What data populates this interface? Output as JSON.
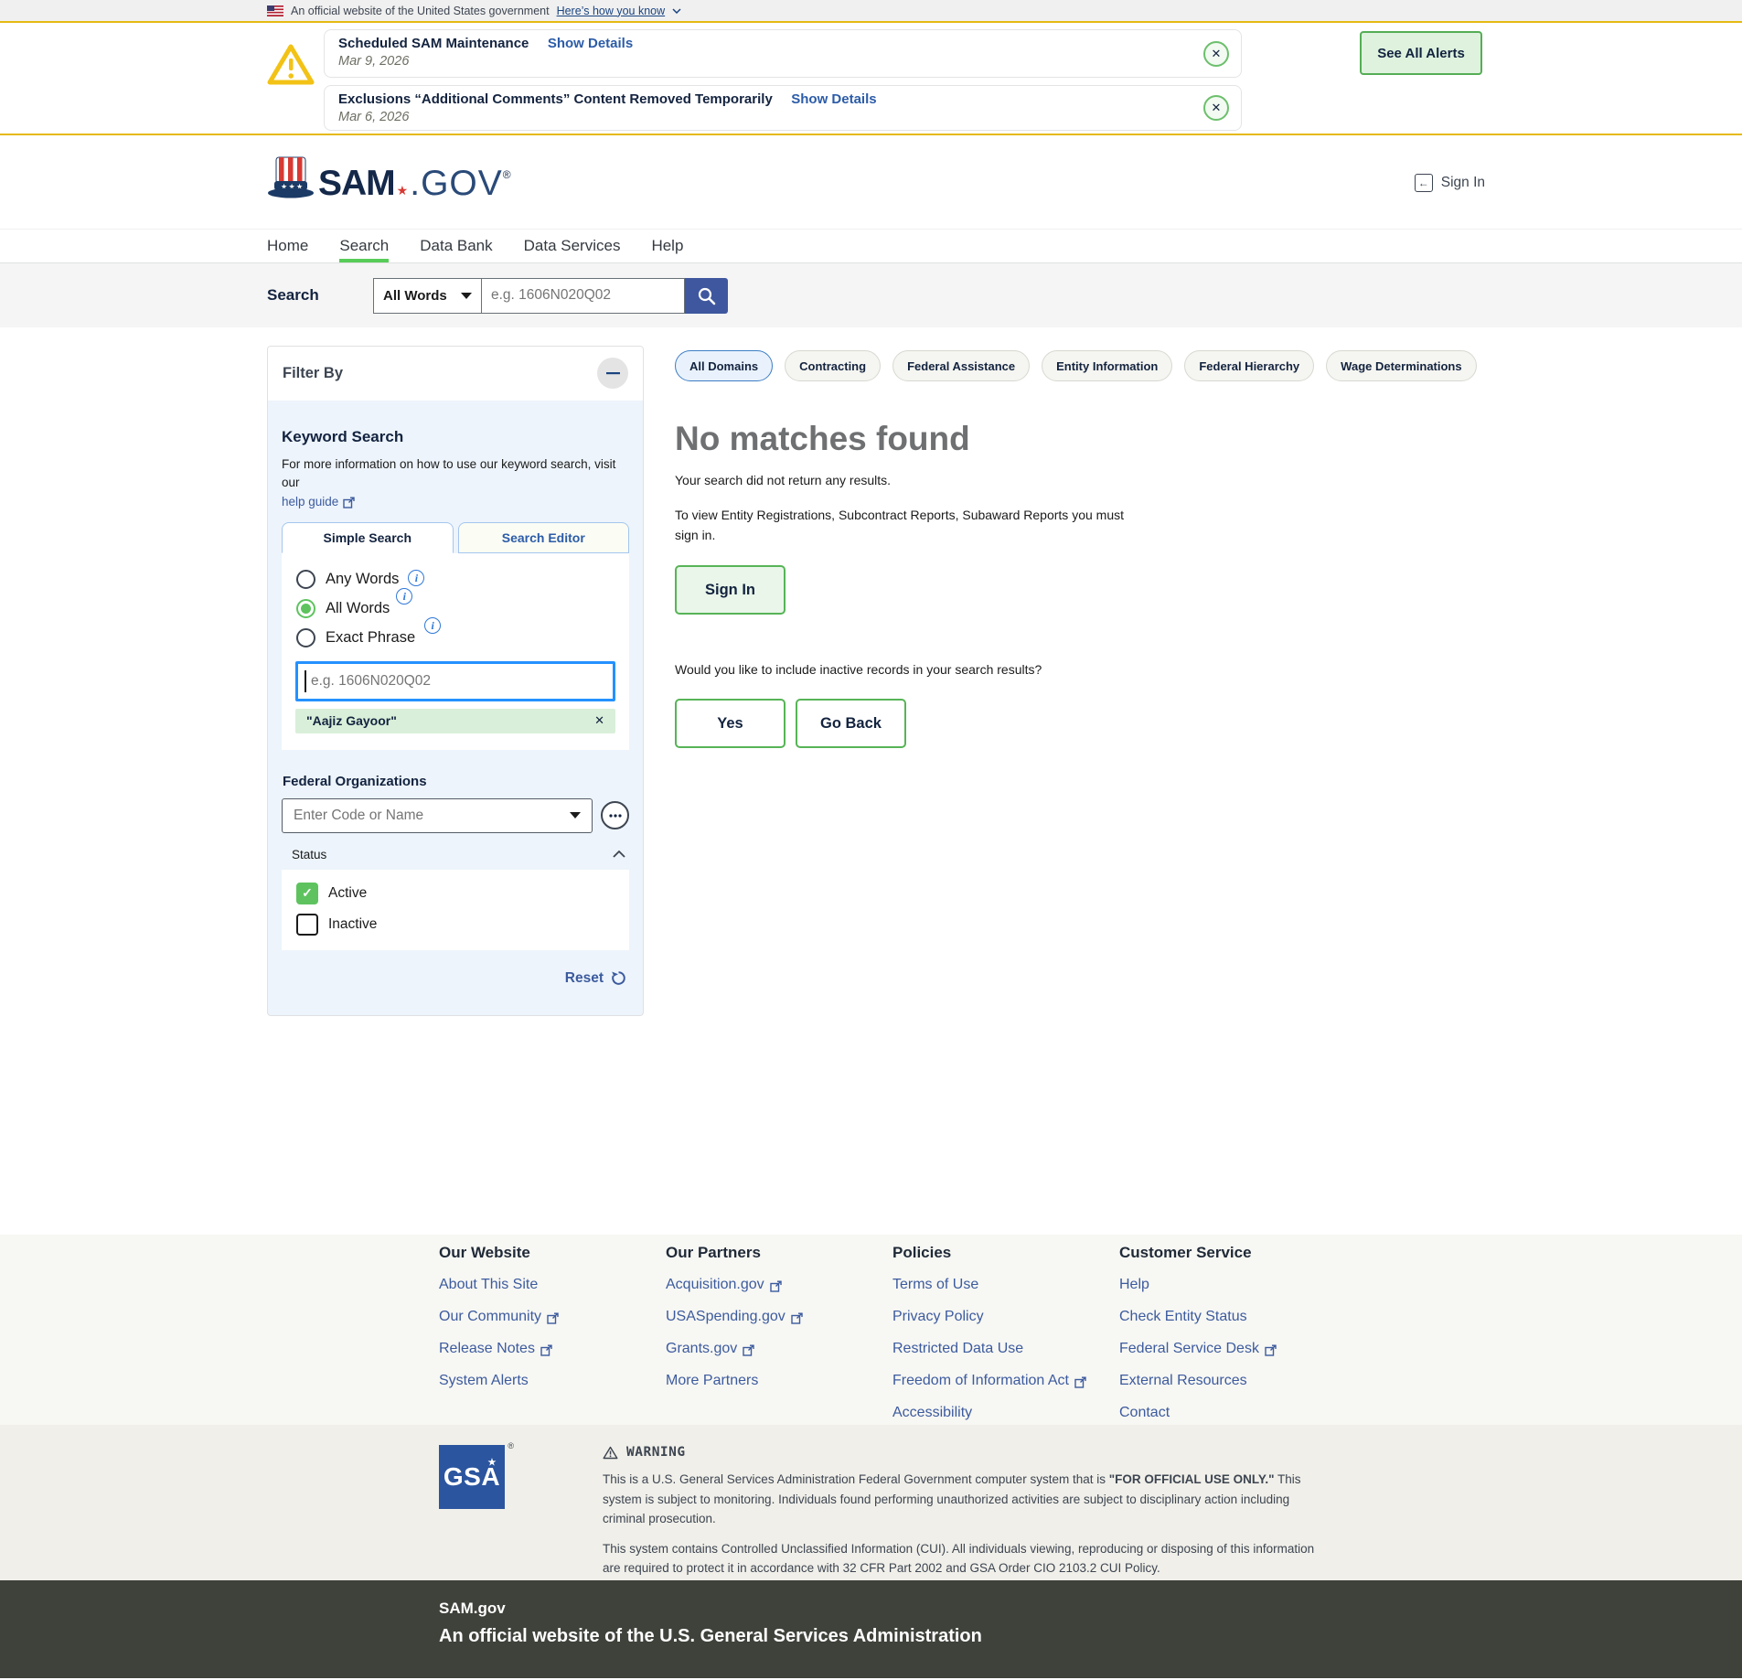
{
  "banner": {
    "text": "An official website of the United States government",
    "link": "Here’s how you know"
  },
  "alerts": {
    "see_all": "See All Alerts",
    "items": [
      {
        "title": "Scheduled SAM Maintenance",
        "details_label": "Show Details",
        "date": "Mar 9, 2026"
      },
      {
        "title": "Exclusions “Additional Comments” Content Removed Temporarily",
        "details_label": "Show Details",
        "date": "Mar 6, 2026"
      }
    ]
  },
  "header": {
    "logo_sam": "SAM",
    "logo_star": "★",
    "logo_gov": ".GOV",
    "logo_reg": "®",
    "sign_in": "Sign In"
  },
  "nav": {
    "items": [
      {
        "label": "Home"
      },
      {
        "label": "Search",
        "active": true
      },
      {
        "label": "Data Bank"
      },
      {
        "label": "Data Services"
      },
      {
        "label": "Help"
      }
    ]
  },
  "searchbar": {
    "label": "Search",
    "mode": "All Words",
    "placeholder": "e.g. 1606N020Q02"
  },
  "filter": {
    "title": "Filter By",
    "keyword": {
      "heading": "Keyword Search",
      "info": "For more information on how to use our keyword search, visit our",
      "help_link": "help guide",
      "tabs": [
        "Simple Search",
        "Search Editor"
      ],
      "options": [
        {
          "label": "Any Words",
          "selected": false
        },
        {
          "label": "All Words",
          "selected": true
        },
        {
          "label": "Exact Phrase",
          "selected": false
        }
      ],
      "input_placeholder": "e.g. 1606N020Q02",
      "tag": "\"Aajiz Gayoor\""
    },
    "federal_orgs": {
      "heading": "Federal Organizations",
      "placeholder": "Enter Code or Name"
    },
    "status": {
      "label": "Status",
      "options": [
        {
          "label": "Active",
          "checked": true
        },
        {
          "label": "Inactive",
          "checked": false
        }
      ]
    },
    "reset_label": "Reset"
  },
  "results": {
    "domains": [
      {
        "label": "All Domains",
        "active": true
      },
      {
        "label": "Contracting",
        "active": false
      },
      {
        "label": "Federal Assistance",
        "active": false
      },
      {
        "label": "Entity Information",
        "active": false
      },
      {
        "label": "Federal Hierarchy",
        "active": false
      },
      {
        "label": "Wage Determinations",
        "active": false
      }
    ],
    "title": "No matches found",
    "message1": "Your search did not return any results.",
    "message2": "To view Entity Registrations, Subcontract Reports, Subaward Reports you must sign in.",
    "sign_in_button": "Sign In",
    "question": "Would you like to include inactive records in your search results?",
    "yes_button": "Yes",
    "go_back_button": "Go Back"
  },
  "footer": {
    "columns": [
      {
        "heading": "Our Website",
        "links": [
          {
            "label": "About This Site",
            "external": false
          },
          {
            "label": "Our Community",
            "external": true
          },
          {
            "label": "Release Notes",
            "external": true
          },
          {
            "label": "System Alerts",
            "external": false
          }
        ]
      },
      {
        "heading": "Our Partners",
        "links": [
          {
            "label": "Acquisition.gov",
            "external": true
          },
          {
            "label": "USASpending.gov",
            "external": true
          },
          {
            "label": "Grants.gov",
            "external": true
          },
          {
            "label": "More Partners",
            "external": false
          }
        ]
      },
      {
        "heading": "Policies",
        "links": [
          {
            "label": "Terms of Use",
            "external": false
          },
          {
            "label": "Privacy Policy",
            "external": false
          },
          {
            "label": "Restricted Data Use",
            "external": false
          },
          {
            "label": "Freedom of Information Act",
            "external": true
          },
          {
            "label": "Accessibility",
            "external": false
          }
        ]
      },
      {
        "heading": "Customer Service",
        "links": [
          {
            "label": "Help",
            "external": false
          },
          {
            "label": "Check Entity Status",
            "external": false
          },
          {
            "label": "Federal Service Desk",
            "external": true
          },
          {
            "label": "External Resources",
            "external": false
          },
          {
            "label": "Contact",
            "external": false
          }
        ]
      }
    ],
    "gsa_label": "GSA",
    "gsa_reg": "®",
    "warning": {
      "heading": "WARNING",
      "p1_before": "This is a U.S. General Services Administration Federal Government computer system that is ",
      "p1_bold": "\"FOR OFFICIAL USE ONLY.\"",
      "p1_after": " This system is subject to monitoring. Individuals found performing unauthorized activities are subject to disciplinary action including criminal prosecution.",
      "p2": "This system contains Controlled Unclassified Information (CUI). All individuals viewing, reproducing or disposing of this information are required to protect it in accordance with 32 CFR Part 2002 and GSA Order CIO 2103.2 CUI Policy."
    },
    "bottom": {
      "title": "SAM.gov",
      "subtitle": "An official website of the U.S. General Services Administration"
    }
  },
  "icons": {
    "close": "✕",
    "ellipsis": "•••",
    "check": "✓",
    "enter_arrow": "←"
  },
  "colors": {
    "gold": "#e5ba13",
    "accent_green": "#57b457",
    "link_blue": "#3c5b9e",
    "navy": "#13233f",
    "search_button_blue": "#3f579e",
    "focus_blue": "#2491ff",
    "nav_underline_green": "#58cc58",
    "active_chip_border": "#3d7dc4",
    "gsa_blue": "#2b559f",
    "footer_dark": "#3f423a"
  }
}
